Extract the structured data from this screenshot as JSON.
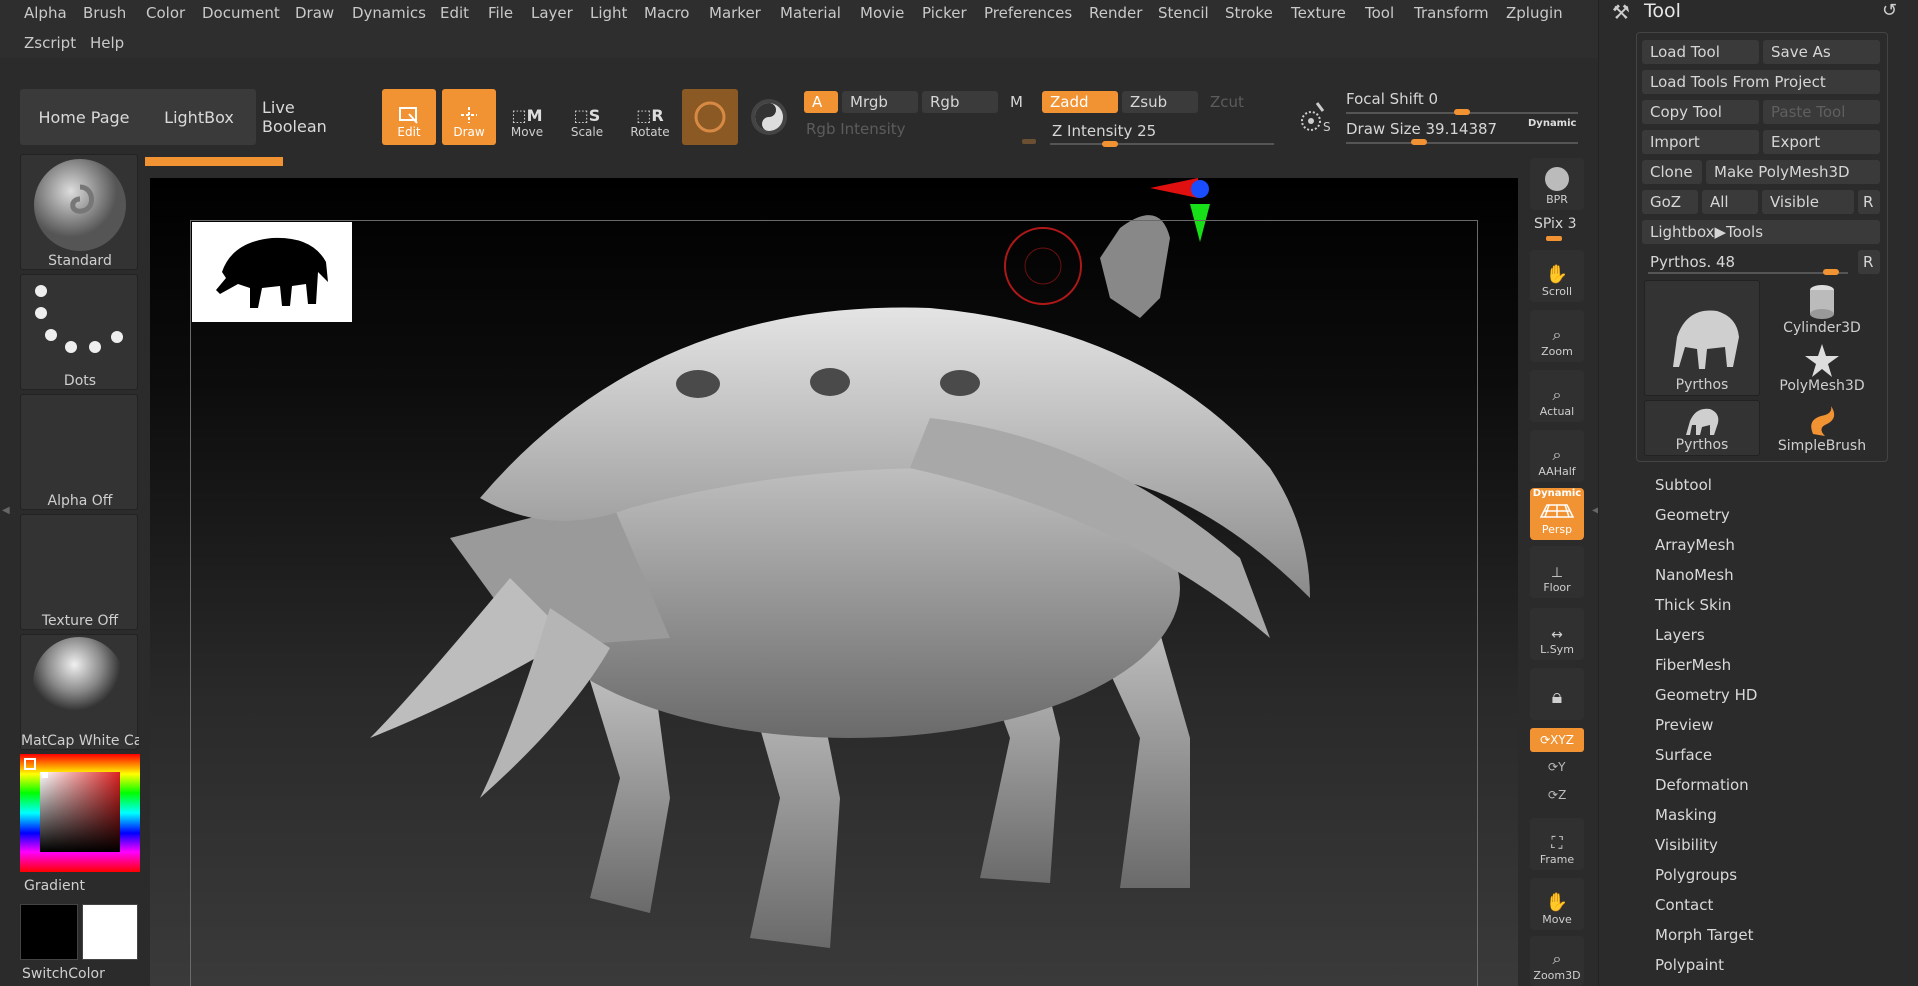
{
  "menu": [
    "Alpha",
    "Brush",
    "Color",
    "Document",
    "Draw",
    "Dynamics",
    "Edit",
    "File",
    "Layer",
    "Light",
    "Macro",
    "Marker",
    "Material",
    "Movie",
    "Picker",
    "Preferences",
    "Render",
    "Stencil",
    "Stroke",
    "Texture",
    "Tool",
    "Transform",
    "Zplugin",
    "Zscript",
    "Help"
  ],
  "toolbar": {
    "home_page": "Home Page",
    "lightbox": "LightBox",
    "live_boolean": "Live Boolean",
    "edit": "Edit",
    "draw": "Draw",
    "move": "Move",
    "scale": "Scale",
    "rotate": "Rotate",
    "a": "A",
    "mrgb": "Mrgb",
    "rgb": "Rgb",
    "m": "M",
    "rgb_intensity": "Rgb Intensity",
    "zadd": "Zadd",
    "zsub": "Zsub",
    "zcut": "Zcut",
    "z_intensity": "Z Intensity 25",
    "focal_shift": "Focal Shift 0",
    "draw_size": "Draw Size 39.14387",
    "dynamic": "Dynamic",
    "z_intensity_level": 0.25,
    "focal_shift_level": 0.5,
    "draw_size_level": 0.3
  },
  "left_shelf": {
    "brush": "Standard",
    "stroke": "Dots",
    "alpha": "Alpha Off",
    "texture": "Texture Off",
    "material": "MatCap White Ca",
    "gradient": "Gradient",
    "switch_color": "SwitchColor"
  },
  "right_shelf": {
    "bpr": "BPR",
    "spix": "SPix 3",
    "scroll": "Scroll",
    "zoom": "Zoom",
    "actual": "Actual",
    "aahalf": "AAHalf",
    "dynamic": "Dynamic",
    "persp": "Persp",
    "floor": "Floor",
    "lsym": "L.Sym",
    "xyz": "XYZ",
    "y": "Y",
    "z": "Z",
    "frame": "Frame",
    "move": "Move",
    "zoom3d": "Zoom3D"
  },
  "tool_panel": {
    "title": "Tool",
    "load_tool": "Load Tool",
    "save_as": "Save As",
    "load_from_project": "Load Tools From Project",
    "copy_tool": "Copy Tool",
    "paste_tool": "Paste Tool",
    "import": "Import",
    "export": "Export",
    "clone": "Clone",
    "make_polymesh": "Make PolyMesh3D",
    "goz": "GoZ",
    "all": "All",
    "visible": "Visible",
    "r": "R",
    "lightbox_tools": "Lightbox▶Tools",
    "pythos_slider": "Pyrthos. 48",
    "pythos_level": 0.95,
    "thumbs": [
      "Pyrthos",
      "Cylinder3D",
      "PolyMesh3D",
      "Pyrthos",
      "SimpleBrush"
    ],
    "sections": [
      "Subtool",
      "Geometry",
      "ArrayMesh",
      "NanoMesh",
      "Thick Skin",
      "Layers",
      "FiberMesh",
      "Geometry HD",
      "Preview",
      "Surface",
      "Deformation",
      "Masking",
      "Visibility",
      "Polygroups",
      "Contact",
      "Morph Target",
      "Polypaint"
    ]
  },
  "colors": {
    "accent": "#f29333",
    "primary_swatch": "#000000",
    "secondary_swatch": "#ffffff"
  }
}
